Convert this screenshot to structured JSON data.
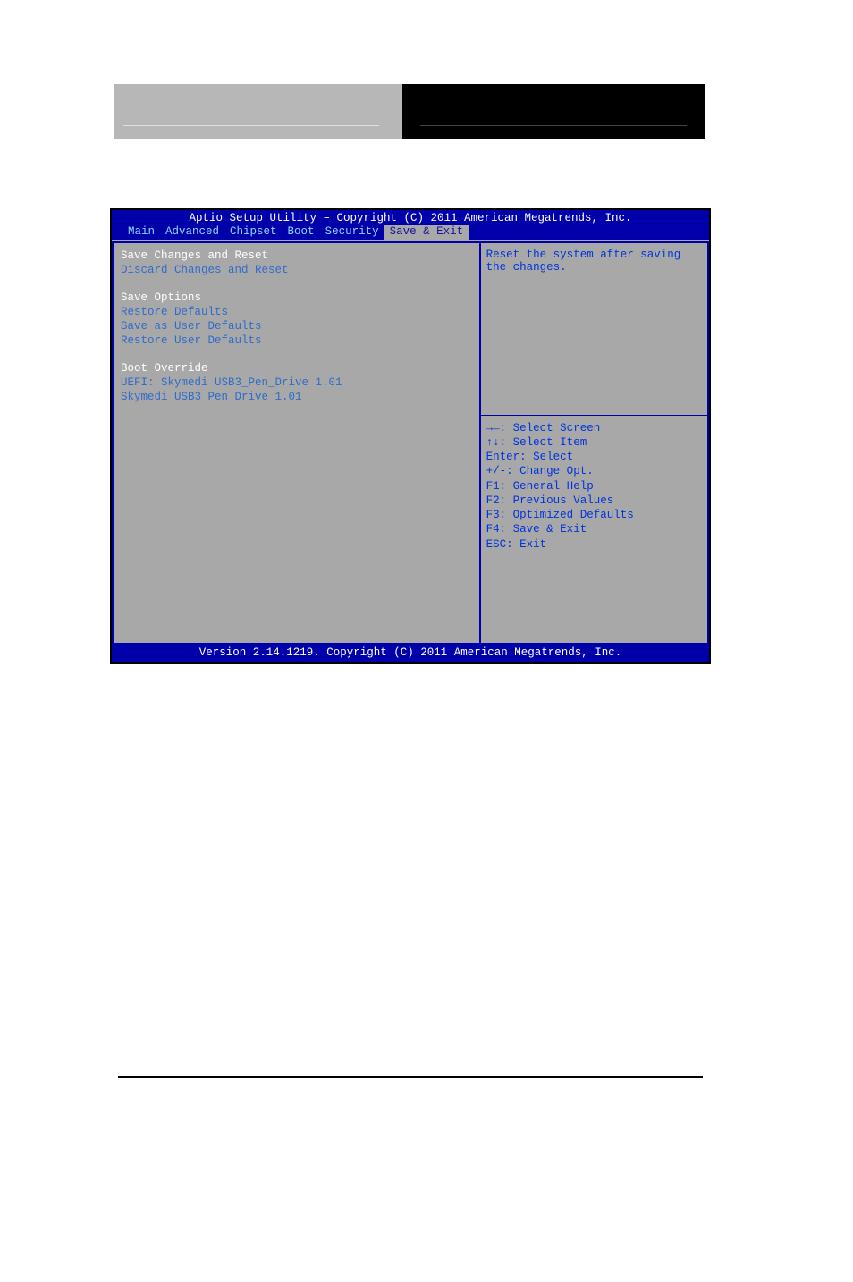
{
  "bios": {
    "header_title": "Aptio Setup Utility – Copyright (C) 2011 American Megatrends, Inc.",
    "tabs": [
      "Main",
      "Advanced",
      "Chipset",
      "Boot",
      "Security",
      "Save & Exit"
    ],
    "active_tab_index": 5,
    "menu": {
      "save_changes_reset": "Save Changes and Reset",
      "discard_changes_reset": "Discard Changes and Reset",
      "heading_save_options": "Save Options",
      "restore_defaults": "Restore Defaults",
      "save_user_defaults": "Save as User Defaults",
      "restore_user_defaults": "Restore User Defaults",
      "heading_boot_override": "Boot Override",
      "boot_uefi": "UEFI: Skymedi USB3_Pen_Drive 1.01",
      "boot_device": "Skymedi USB3_Pen_Drive 1.01"
    },
    "help_text": "Reset the system after saving the changes.",
    "keys": {
      "select_screen": "→←: Select Screen",
      "select_item": "↑↓: Select Item",
      "enter": "Enter: Select",
      "change_opt": "+/-: Change Opt.",
      "f1": "F1: General Help",
      "f2": "F2: Previous Values",
      "f3": "F3: Optimized Defaults",
      "f4": "F4: Save & Exit",
      "esc": "ESC: Exit"
    },
    "footer": "Version 2.14.1219. Copyright (C) 2011 American Megatrends, Inc."
  }
}
